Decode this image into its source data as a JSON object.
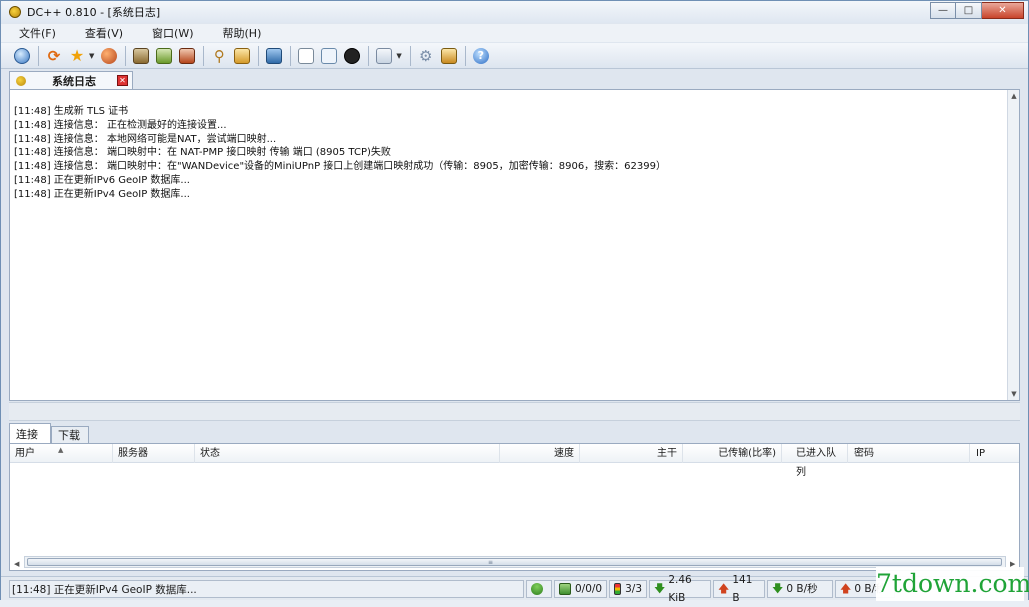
{
  "window": {
    "title": "DC++ 0.810 - [系统日志]"
  },
  "menu": [
    "文件(F)",
    "查看(V)",
    "窗口(W)",
    "帮助(H)"
  ],
  "toolbar": {
    "icons": [
      "globe-icon",
      "refresh-icon",
      "star-icon",
      "users-icon",
      "queue-icon",
      "finished-icon",
      "upload-finished-icon",
      "search-icon",
      "search-spy-icon",
      "notepad-icon",
      "filelist-icon",
      "open-filelist-icon",
      "recent-icon",
      "dropdown-icon",
      "settings-icon",
      "edit-icon",
      "help-icon"
    ]
  },
  "tabs": [
    {
      "label": "系统日志",
      "active": true
    }
  ],
  "log": [
    "[11:48] 生成新 TLS 证书",
    "[11:48] 连接信息： 正在检测最好的连接设置...",
    "[11:48] 连接信息： 本地网络可能是NAT，尝试端口映射...",
    "[11:48] 连接信息： 端口映射中：在 NAT-PMP 接口映射 传输 端口 (8905 TCP)失败",
    "[11:48] 连接信息： 端口映射中：在\"WANDevice\"设备的MiniUPnP 接口上创建端口映射成功（传输：8905，加密传输：8906，搜索：62399）",
    "[11:48] 正在更新IPv6 GeoIP 数据库...",
    "[11:48] 正在更新IPv4 GeoIP 数据库..."
  ],
  "bottom_tabs": [
    {
      "label": "连接",
      "active": true
    },
    {
      "label": "下载",
      "active": false
    }
  ],
  "columns": [
    "用户",
    "服务器",
    "状态",
    "速度",
    "主干",
    "已传输(比率)",
    "已进入队列",
    "密码",
    "IP"
  ],
  "status": {
    "message": "[11:48] 正在更新IPv4 GeoIP 数据库...",
    "hubs": "0/0/0",
    "slots": "3/3",
    "down_total": "2.46 KiB",
    "up_total": "141 B",
    "down_speed": "0 B/秒",
    "up_speed": "0 B/秒"
  },
  "watermark": "7tdown.com"
}
